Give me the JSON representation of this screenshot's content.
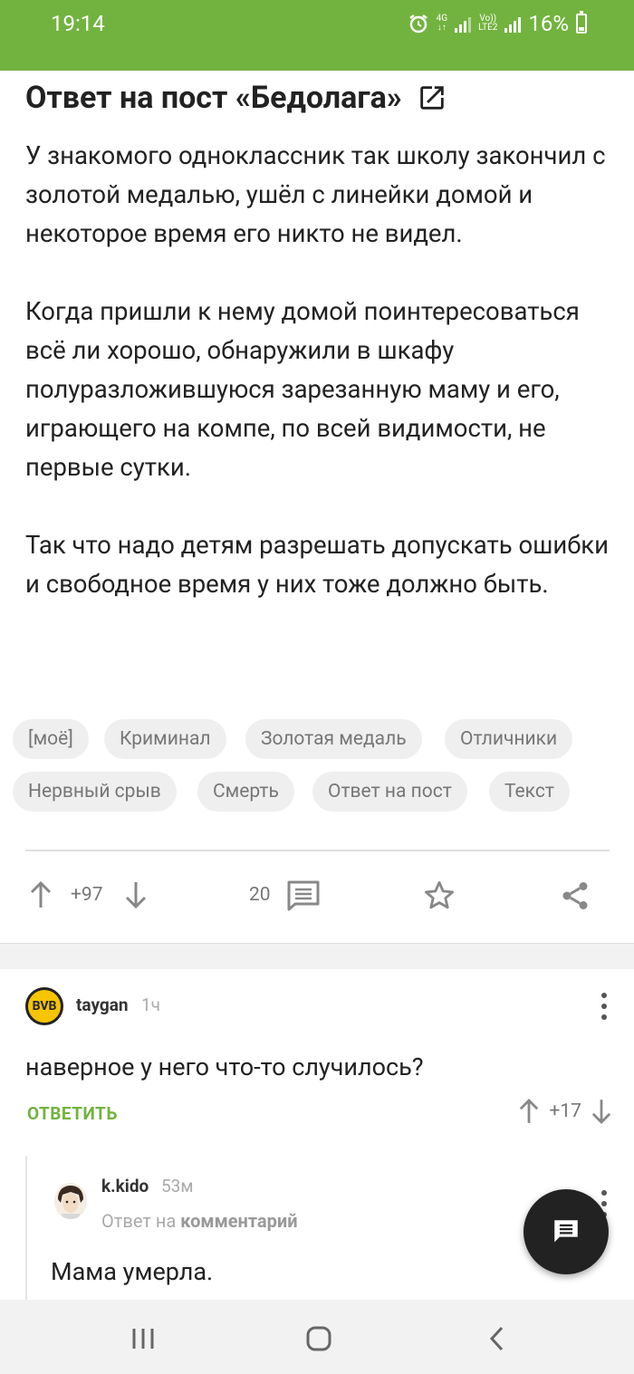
{
  "status_bar": {
    "time": "19:14",
    "net_4g": "4G",
    "volte": "Vo))",
    "lte": "LTE2",
    "battery": "16%"
  },
  "post": {
    "title": "Ответ на пост «Бедолага»",
    "paragraphs": [
      "У знакомого одноклассник так школу закончил с золотой медалью, ушёл с линейки домой и некоторое время его никто не видел.",
      "Когда пришли к нему домой поинтересоваться всё ли хорошо, обнаружили в шкафу полуразложившуюся зарезанную маму и его, играющего на компе, по всей видимости, не первые сутки.",
      "Так что надо детям разрешать допускать ошибки и свободное время у них тоже должно быть."
    ],
    "tags": [
      "[моё]",
      "Криминал",
      "Золотая медаль",
      "Отличники",
      "Нервный срыв",
      "Смерть",
      "Ответ на пост",
      "Текст"
    ],
    "rating": "+97",
    "comments_count": "20"
  },
  "comments": [
    {
      "author": "taygan",
      "time": "1ч",
      "avatar_text": "BVB",
      "text": "наверное у него что-то случилось?",
      "reply_label": "ОТВЕТИТЬ",
      "rating": "+17"
    },
    {
      "author": "k.kido",
      "time": "53м",
      "reply_to_prefix": "Ответ на",
      "reply_to_target": "комментарий",
      "text": "Мама умерла."
    }
  ],
  "colors": {
    "brand_green": "#72b33f",
    "fab": "#222222",
    "tag_bg": "#efefef"
  }
}
